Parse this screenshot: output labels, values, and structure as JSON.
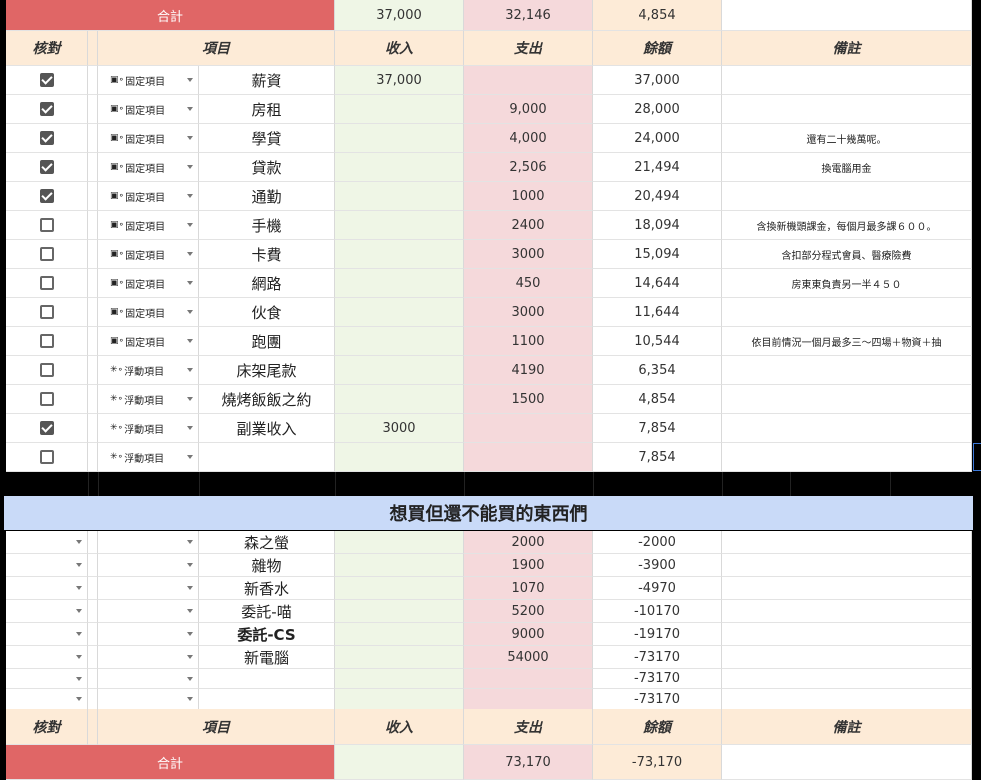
{
  "top_total": {
    "label": "合計",
    "income": "37,000",
    "expense": "32,146",
    "balance": "4,854"
  },
  "headers": {
    "check": "核對",
    "item": "項目",
    "income": "收入",
    "expense": "支出",
    "balance": "餘額",
    "note": "備註"
  },
  "categories": {
    "fixed": "固定項目",
    "floating": "浮動項目"
  },
  "rows": [
    {
      "checked": true,
      "cat": "fixed",
      "name": "薪資",
      "income": "37,000",
      "expense": "",
      "balance": "37,000",
      "note": ""
    },
    {
      "checked": true,
      "cat": "fixed",
      "name": "房租",
      "income": "",
      "expense": "9,000",
      "balance": "28,000",
      "note": ""
    },
    {
      "checked": true,
      "cat": "fixed",
      "name": "學貸",
      "income": "",
      "expense": "4,000",
      "balance": "24,000",
      "note": "還有二十幾萬呢。"
    },
    {
      "checked": true,
      "cat": "fixed",
      "name": "貸款",
      "income": "",
      "expense": "2,506",
      "balance": "21,494",
      "note": "換電腦用金"
    },
    {
      "checked": true,
      "cat": "fixed",
      "name": "通勤",
      "income": "",
      "expense": "1000",
      "balance": "20,494",
      "note": ""
    },
    {
      "checked": false,
      "cat": "fixed",
      "name": "手機",
      "income": "",
      "expense": "2400",
      "balance": "18,094",
      "note": "含換新機頭課金，每個月最多課６００。"
    },
    {
      "checked": false,
      "cat": "fixed",
      "name": "卡費",
      "income": "",
      "expense": "3000",
      "balance": "15,094",
      "note": "含扣部分程式會員、醫療險費"
    },
    {
      "checked": false,
      "cat": "fixed",
      "name": "網路",
      "income": "",
      "expense": "450",
      "balance": "14,644",
      "note": "房東東負責另一半４５０"
    },
    {
      "checked": false,
      "cat": "fixed",
      "name": "伙食",
      "income": "",
      "expense": "3000",
      "balance": "11,644",
      "note": ""
    },
    {
      "checked": false,
      "cat": "fixed",
      "name": "跑團",
      "income": "",
      "expense": "1100",
      "balance": "10,544",
      "note": "依目前情況一個月最多三～四場＋物資＋抽"
    },
    {
      "checked": false,
      "cat": "floating",
      "name": "床架尾款",
      "income": "",
      "expense": "4190",
      "balance": "6,354",
      "note": ""
    },
    {
      "checked": false,
      "cat": "floating",
      "name": "燒烤飯飯之約",
      "income": "",
      "expense": "1500",
      "balance": "4,854",
      "note": ""
    },
    {
      "checked": true,
      "cat": "floating",
      "name": "副業收入",
      "income": "3000",
      "expense": "",
      "balance": "7,854",
      "note": ""
    },
    {
      "checked": false,
      "cat": "floating",
      "name": "",
      "income": "",
      "expense": "",
      "balance": "7,854",
      "note": ""
    }
  ],
  "wishlist_title": "想買但還不能買的東西們",
  "wishlist": [
    {
      "name": "森之螢",
      "expense": "2000",
      "balance": "-2000"
    },
    {
      "name": "雜物",
      "expense": "1900",
      "balance": "-3900"
    },
    {
      "name": "新香水",
      "expense": "1070",
      "balance": "-4970"
    },
    {
      "name": "委託-喵",
      "expense": "5200",
      "balance": "-10170"
    },
    {
      "name": "委託-CS",
      "expense": "9000",
      "balance": "-19170"
    },
    {
      "name": "新電腦",
      "expense": "54000",
      "balance": "-73170"
    },
    {
      "name": "",
      "expense": "",
      "balance": "-73170"
    },
    {
      "name": "",
      "expense": "",
      "balance": "-73170"
    }
  ],
  "bottom_total": {
    "label": "合計",
    "income": "",
    "expense": "73,170",
    "balance": "-73,170"
  }
}
